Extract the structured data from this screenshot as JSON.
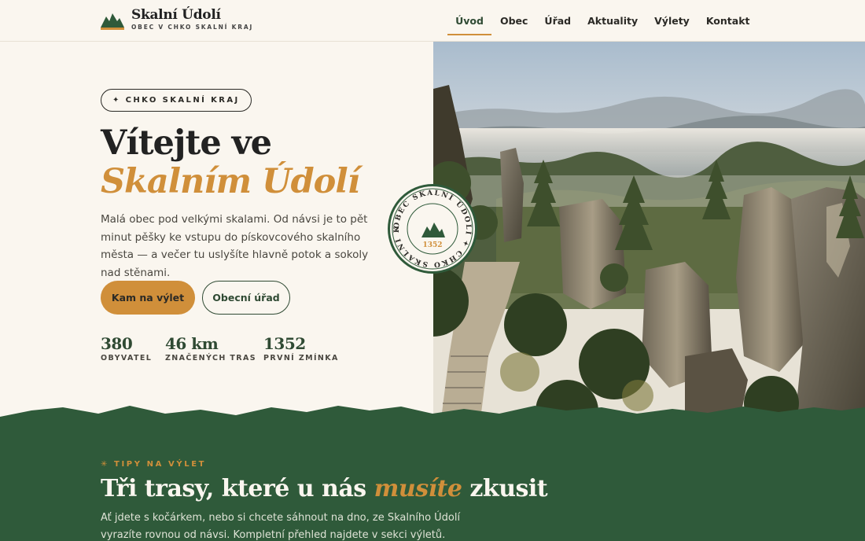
{
  "brand": {
    "title": "Skalní Údolí",
    "subtitle": "OBEC V CHKO SKALNÍ KRAJ"
  },
  "nav": {
    "items": [
      {
        "label": "Úvod",
        "active": true
      },
      {
        "label": "Obec",
        "active": false
      },
      {
        "label": "Úřad",
        "active": false
      },
      {
        "label": "Aktuality",
        "active": false
      },
      {
        "label": "Výlety",
        "active": false
      },
      {
        "label": "Kontakt",
        "active": false
      }
    ]
  },
  "hero": {
    "badge": "✦ CHKO SKALNÍ KRAJ",
    "title_part1": "Vítejte ve ",
    "title_accent": "Skalním Údolí",
    "description": "Malá obec pod velkými skalami. Od návsi je to pět minut pěšky ke vstupu do pískovcového skalního města — a večer tu uslyšíte hlavně potok a sokoly nad stěnami.",
    "primary_button": "Kam na výlet",
    "secondary_button": "Obecní úřad",
    "stats": [
      {
        "value": "380",
        "label": "OBYVATEL"
      },
      {
        "value": "46 km",
        "label": "ZNAČENÝCH TRAS"
      },
      {
        "value": "1352",
        "label": "PRVNÍ ZMÍNKA"
      }
    ]
  },
  "seal": {
    "ring_text": "OBEC SKALNÍ ÚDOLÍ ✦ CHKO SKALNÍ KRAJ ✦",
    "year": "1352"
  },
  "tips": {
    "kicker": "✳ TIPY NA VÝLET",
    "title_part1": "Tři trasy, které u nás ",
    "title_accent": "musíte",
    "title_part2": " zkusit",
    "description": "Ať jdete s kočárkem, nebo si chcete sáhnout na dno, ze Skalního Údolí vyrazíte rovnou od návsi. Kompletní přehled najdete v sekci výletů."
  },
  "colors": {
    "accent": "#d08f3a",
    "forest": "#2f5a3a",
    "cream": "#faf6ef"
  }
}
